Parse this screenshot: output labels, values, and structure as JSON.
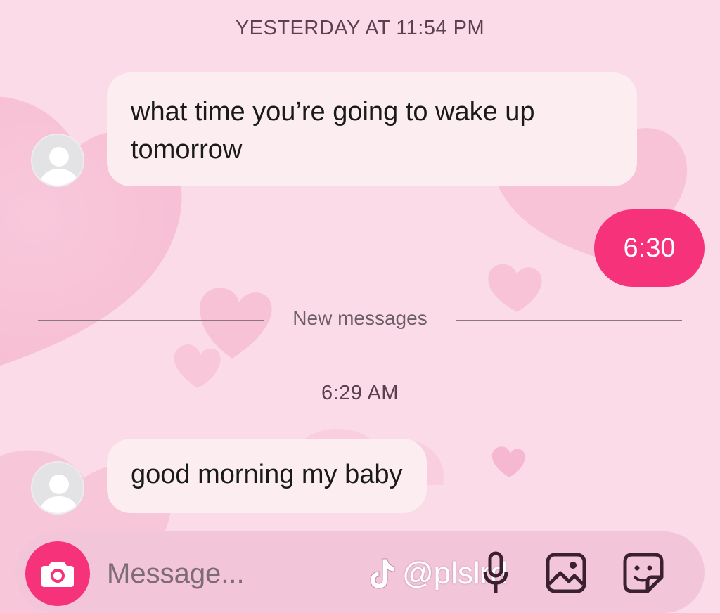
{
  "thread": {
    "timestamp_1": "YESTERDAY AT 11:54 PM",
    "msg_1": "what time you’re going to wake up tomorrow",
    "reply_1": "6:30",
    "divider": "New messages",
    "timestamp_2": "6:29 AM",
    "msg_2": "good morning my baby"
  },
  "composer": {
    "placeholder": "Message...",
    "icons": [
      "camera-icon",
      "microphone-icon",
      "gallery-icon",
      "sticker-icon"
    ]
  },
  "watermark": {
    "logo": "tiktok-logo",
    "handle": "@plslrd"
  },
  "colors": {
    "background": "#fbdbe8",
    "accent": "#f6327b",
    "incoming_bubble": "#fcedf1"
  }
}
